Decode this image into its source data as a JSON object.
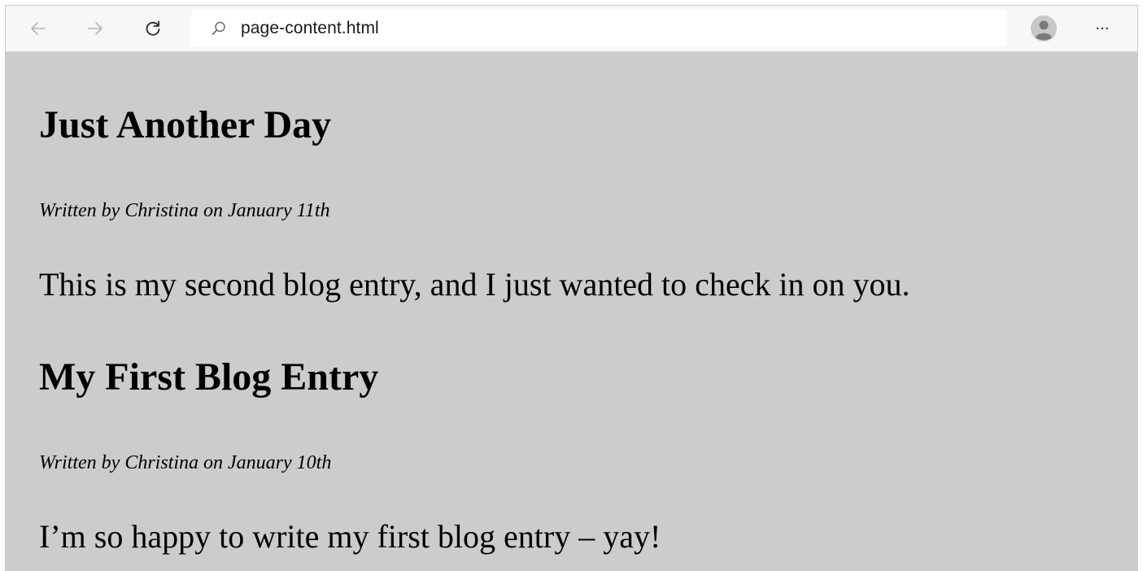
{
  "browser": {
    "address": "page-content.html",
    "more_label": "···"
  },
  "posts": [
    {
      "title": "Just Another Day",
      "meta": "Written by Christina on January 11th",
      "body": "This is my second blog entry, and I just wanted to check in on you."
    },
    {
      "title": "My First Blog Entry",
      "meta": "Written by Christina on January 10th",
      "body": "I’m so happy to write my first blog entry – yay!"
    }
  ],
  "icons": {
    "back": "arrow-left-icon",
    "forward": "arrow-right-icon",
    "refresh": "refresh-icon",
    "search": "search-icon",
    "avatar": "user-avatar-icon",
    "more": "more-icon"
  },
  "colors": {
    "page_background": "#cccccc",
    "toolbar_background": "#f7f7f7",
    "text": "#000000"
  }
}
